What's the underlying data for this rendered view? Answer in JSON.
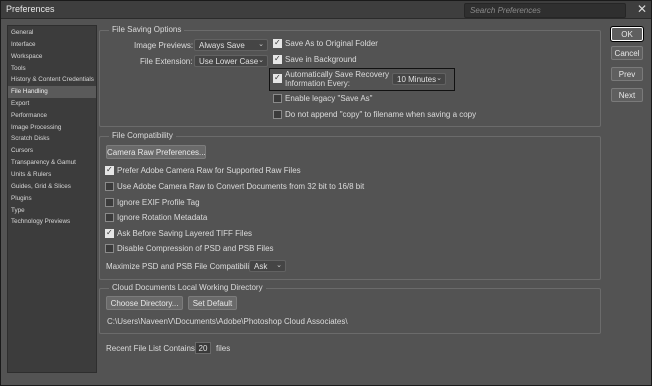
{
  "window": {
    "title": "Preferences",
    "search_placeholder": "Search Preferences",
    "close_glyph": "✕"
  },
  "sidebar": {
    "items": [
      {
        "label": "General"
      },
      {
        "label": "Interface"
      },
      {
        "label": "Workspace"
      },
      {
        "label": "Tools"
      },
      {
        "label": "History & Content Credentials"
      },
      {
        "label": "File Handling"
      },
      {
        "label": "Export"
      },
      {
        "label": "Performance"
      },
      {
        "label": "Image Processing"
      },
      {
        "label": "Scratch Disks"
      },
      {
        "label": "Cursors"
      },
      {
        "label": "Transparency & Gamut"
      },
      {
        "label": "Units & Rulers"
      },
      {
        "label": "Guides, Grid & Slices"
      },
      {
        "label": "Plugins"
      },
      {
        "label": "Type"
      },
      {
        "label": "Technology Previews"
      }
    ],
    "active_index": 5
  },
  "file_saving": {
    "legend": "File Saving Options",
    "image_previews_label": "Image Previews:",
    "image_previews_value": "Always Save",
    "file_extension_label": "File Extension:",
    "file_extension_value": "Use Lower Case",
    "save_original_folder": "Save As to Original Folder",
    "save_background": "Save in Background",
    "auto_save_line1": "Automatically Save Recovery",
    "auto_save_line2": "Information Every:",
    "auto_save_interval": "10 Minutes",
    "legacy_save_as": "Enable legacy \"Save As\"",
    "no_copy": "Do not append \"copy\" to filename when saving a copy"
  },
  "file_compat": {
    "legend": "File Compatibility",
    "camera_raw_button": "Camera Raw Preferences...",
    "prefer_acr": "Prefer Adobe Camera Raw for Supported Raw Files",
    "use_acr_convert": "Use Adobe Camera Raw to Convert Documents from 32 bit to 16/8 bit",
    "ignore_exif": "Ignore EXIF Profile Tag",
    "ignore_rotation": "Ignore Rotation Metadata",
    "ask_tiff": "Ask Before Saving Layered TIFF Files",
    "disable_compression": "Disable Compression of PSD and PSB Files",
    "maximize_label": "Maximize PSD and PSB File Compatibility:",
    "maximize_value": "Ask"
  },
  "cloud": {
    "legend": "Cloud Documents Local Working Directory",
    "choose_button": "Choose Directory...",
    "default_button": "Set Default",
    "path": "C:\\Users\\NaveenV\\Documents\\Adobe\\Photoshop Cloud Associates\\"
  },
  "recent": {
    "label": "Recent File List Contains:",
    "value": "20",
    "suffix": "files"
  },
  "buttons": {
    "ok": "OK",
    "cancel": "Cancel",
    "prev": "Prev",
    "next": "Next"
  }
}
